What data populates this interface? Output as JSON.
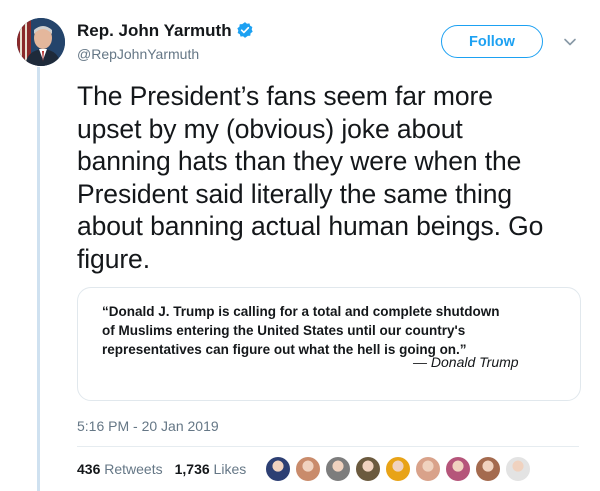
{
  "author": {
    "name": "Rep. John Yarmuth",
    "handle": "@RepJohnYarmuth",
    "verified": true,
    "avatar_icon": "profile-photo"
  },
  "follow_label": "Follow",
  "menu_icon": "chevron-down-icon",
  "tweet": {
    "lines": [
      "The President’s fans seem far more",
      "upset by my (obvious) joke about",
      "banning hats than they were when the",
      "President said literally the same thing",
      "about banning actual human beings. Go",
      "figure."
    ]
  },
  "quote": {
    "lines": [
      "“Donald J. Trump is calling for a total and complete shutdown",
      "of Muslims entering the United States until our country's",
      "representatives can figure out what the hell is going on.”"
    ],
    "attribution": "— Donald Trump"
  },
  "timestamp": "5:16 PM - 20 Jan 2019",
  "stats": {
    "retweets_count": "436",
    "retweets_label": "Retweets",
    "likes_count": "1,736",
    "likes_label": "Likes"
  },
  "liker_avatars": [
    {
      "color": "#2d3f73"
    },
    {
      "color": "#c98b6b"
    },
    {
      "color": "#7d7d7d"
    },
    {
      "color": "#6b5a3e"
    },
    {
      "color": "#e8a317"
    },
    {
      "color": "#d9a28a"
    },
    {
      "color": "#b5557a"
    },
    {
      "color": "#a46a4e"
    },
    {
      "color": "#e3e3e3"
    }
  ],
  "colors": {
    "accent": "#1da1f2",
    "text": "#14171a",
    "muted": "#657786",
    "thread_line": "#cfe1f0"
  }
}
